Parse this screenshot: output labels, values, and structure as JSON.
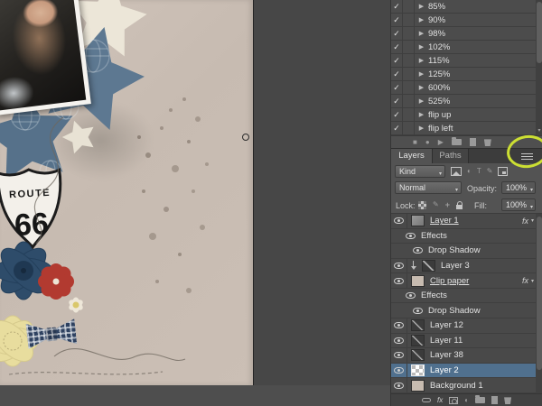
{
  "actions_panel": {
    "items": [
      {
        "label": "85%"
      },
      {
        "label": "90%"
      },
      {
        "label": "98%"
      },
      {
        "label": "102%"
      },
      {
        "label": "115%"
      },
      {
        "label": "125%"
      },
      {
        "label": "600%"
      },
      {
        "label": "525%"
      },
      {
        "label": "flip up"
      },
      {
        "label": "flip left"
      }
    ]
  },
  "icons": {
    "check": "✓",
    "tri_right": "▶",
    "tri_down": "▾",
    "stop": "■",
    "record": "●",
    "play": "▶",
    "adjustment": "◐",
    "text_tool": "T",
    "brush": "✎",
    "plus": "+"
  },
  "layers_panel": {
    "tabs": {
      "layers": "Layers",
      "paths": "Paths"
    },
    "kind_label": "Kind",
    "blend_mode": "Normal",
    "opacity_label": "Opacity:",
    "opacity_value": "100%",
    "lock_label": "Lock:",
    "fill_label": "Fill:",
    "fill_value": "100%",
    "fx_label": "fx",
    "rows": [
      {
        "name": "Layer 1",
        "selected": false
      },
      {
        "name": "Effects",
        "selected": false
      },
      {
        "name": "Drop Shadow",
        "selected": false
      },
      {
        "name": "Layer 3",
        "selected": false
      },
      {
        "name": "Clip paper",
        "selected": false
      },
      {
        "name": "Effects",
        "selected": false
      },
      {
        "name": "Drop Shadow",
        "selected": false
      },
      {
        "name": "Layer 12",
        "selected": false
      },
      {
        "name": "Layer 11",
        "selected": false
      },
      {
        "name": "Layer 38",
        "selected": false
      },
      {
        "name": "Layer 2",
        "selected": true
      },
      {
        "name": "Background 1",
        "selected": false
      }
    ]
  },
  "canvas": {
    "route_shield": {
      "top": "ROUTE",
      "number": "66"
    }
  },
  "colors": {
    "selection": "#50708e",
    "annotation": "#ccdf33",
    "paper": "#c9bcb2",
    "panel": "#4e4e4e"
  }
}
